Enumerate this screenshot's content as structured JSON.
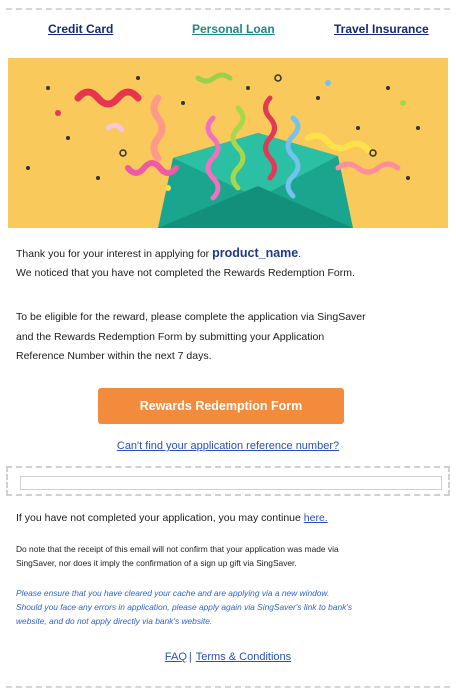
{
  "nav": {
    "credit_card": "Credit Card",
    "personal_loan": "Personal Loan",
    "travel_insurance": "Travel Insurance"
  },
  "hero": {
    "image_subject": "confetti-and-green-envelope",
    "background_color": "#f9c95b"
  },
  "intro": {
    "line1_prefix": "Thank you for your interest in applying for ",
    "product_name": "product_name",
    "line1_suffix": ".",
    "line2": "We noticed that you have not completed the Rewards Redemption Form."
  },
  "eligibility": {
    "line1": "To be eligible for the reward, please complete the application via SingSaver",
    "line2": "and the Rewards Redemption Form by submitting your Application",
    "line3": "Reference Number within the next 7 days."
  },
  "cta": {
    "label": "Rewards Redemption Form",
    "color": "#f38b3c"
  },
  "cant_find_link": "Can't find your application reference number?",
  "continue_text": {
    "prefix": "If you have not completed your application, you may continue ",
    "link": "here."
  },
  "note": {
    "line1": "Do note that the receipt of this email will not confirm that your application was made via",
    "line2": "SingSaver, nor does it imply the confirmation of a sign up gift via SingSaver."
  },
  "warning": {
    "line1": "Please ensure that you have cleared your cache and are applying via a new window.",
    "line2": "Should you face any errors in application, please apply again via SingSaver's link to bank's",
    "line3": "website, and do not apply directly via bank's website."
  },
  "footer": {
    "faq": "FAQ",
    "separator": "|",
    "terms": "Terms & Conditions"
  }
}
